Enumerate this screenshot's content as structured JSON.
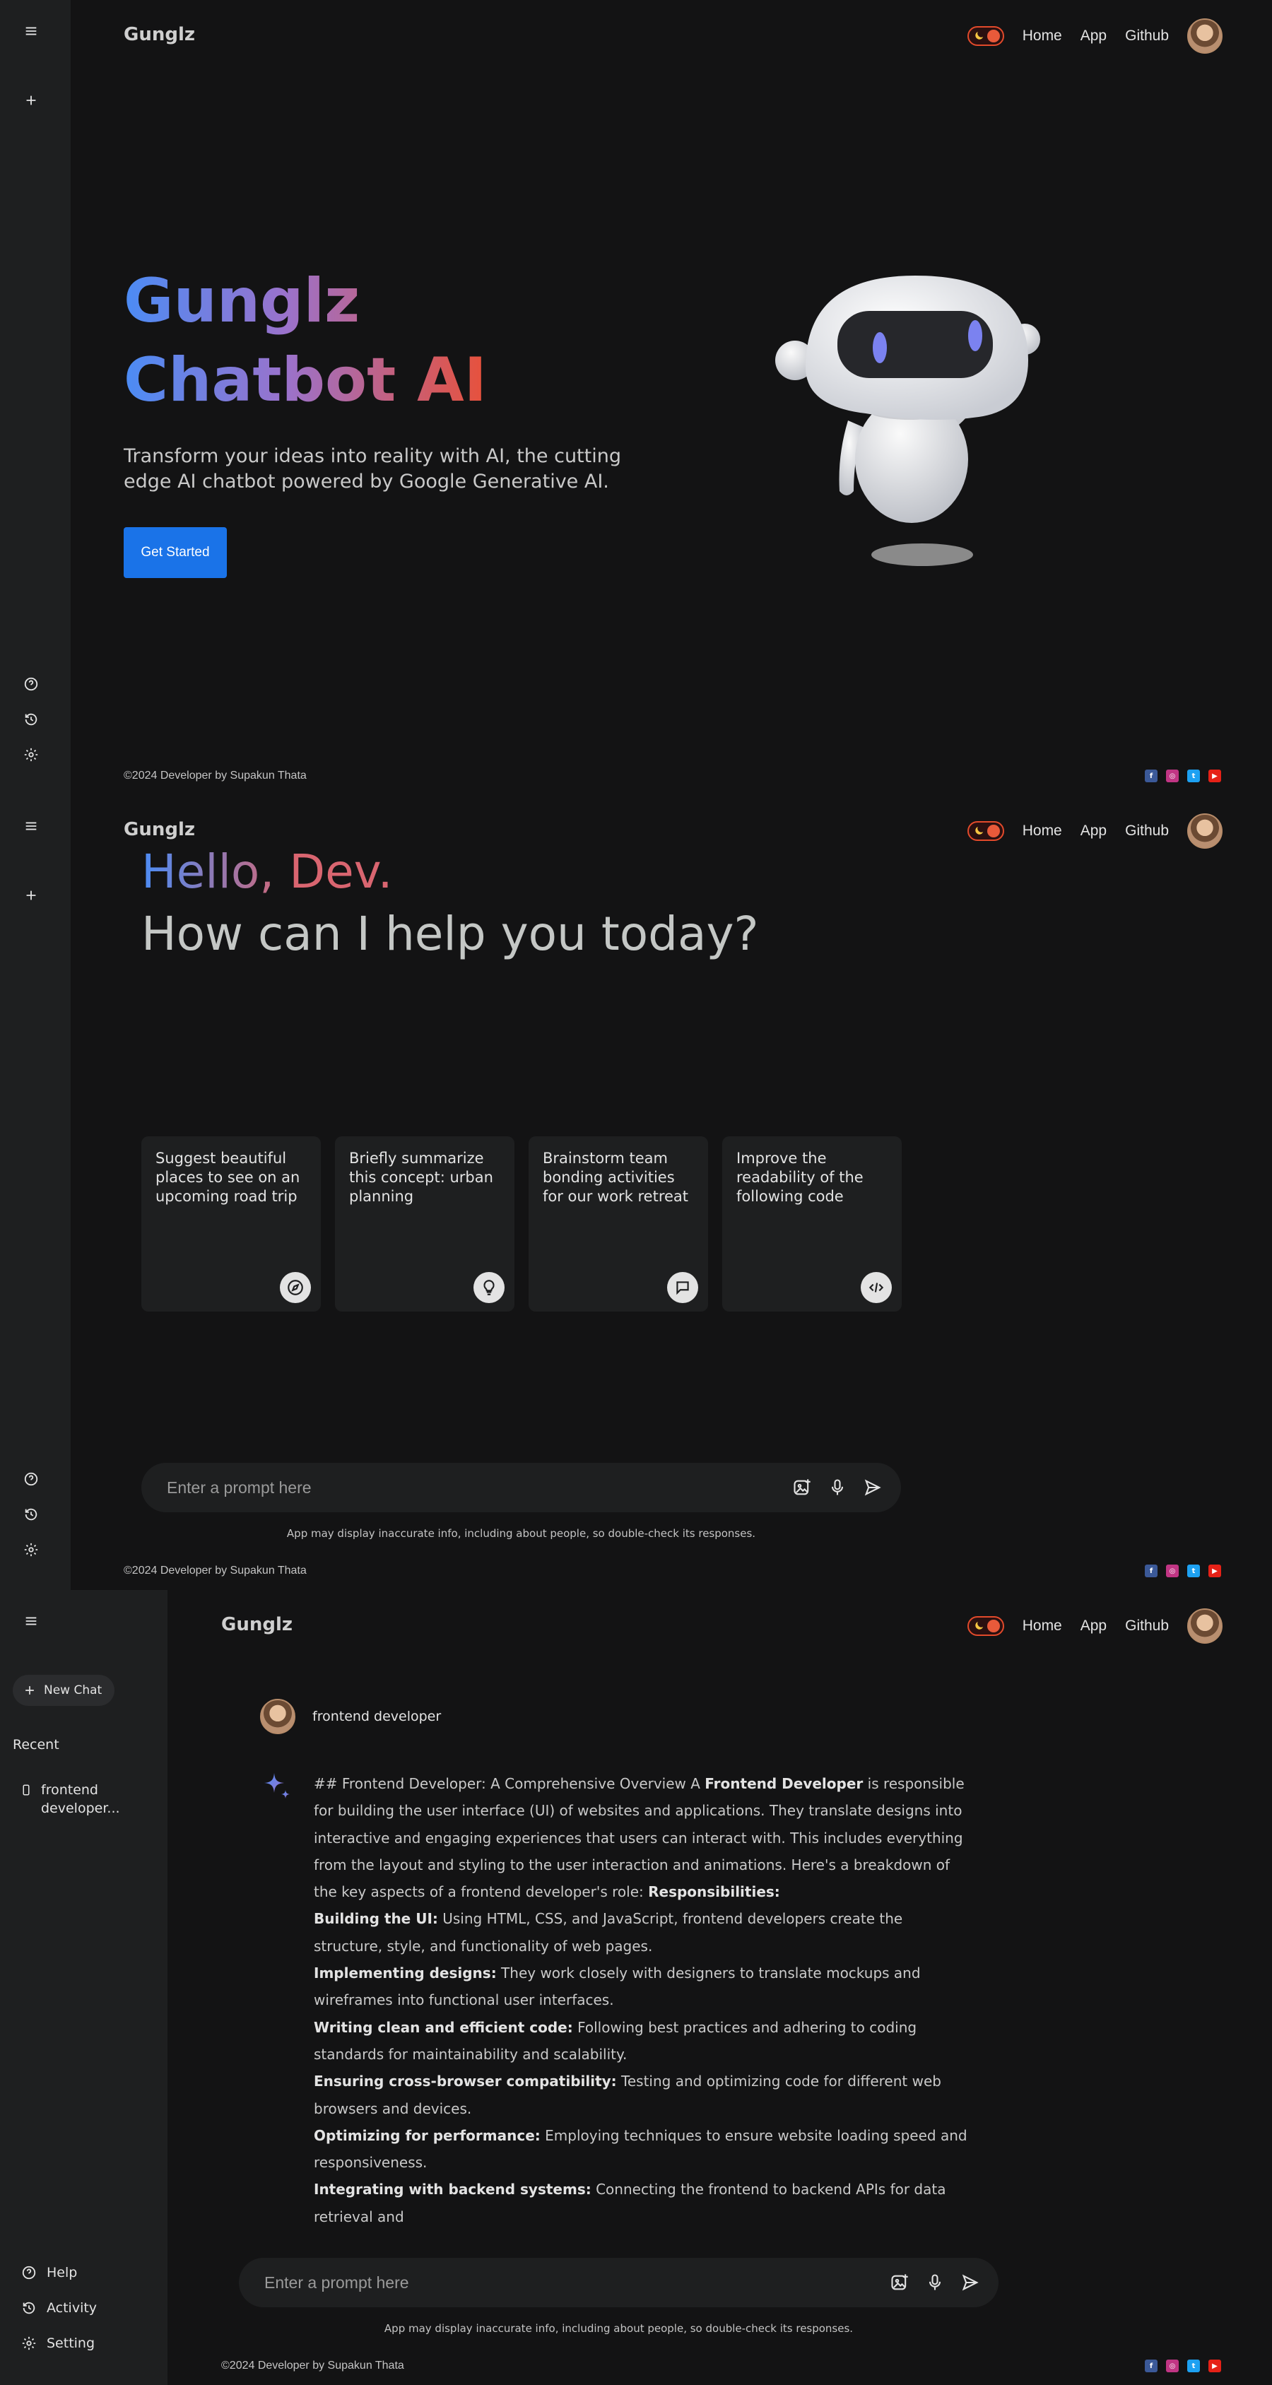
{
  "brand": "Gunglz",
  "nav": {
    "home": "Home",
    "app": "App",
    "github": "Github"
  },
  "footer": {
    "copyright": "©2024 Developer by Supakun Thata"
  },
  "socials": [
    "facebook-icon",
    "instagram-icon",
    "twitter-icon",
    "youtube-icon"
  ],
  "colors": {
    "primary_button": "#1a73e8",
    "toggle_accent": "#e34a2b",
    "gradient_start": "#4b8cf5",
    "gradient_end": "#e8513a"
  },
  "landing": {
    "title_line1": "Gunglz",
    "title_line2": "Chatbot AI",
    "subtitle": "Transform your ideas into reality with AI, the cutting edge AI chatbot powered by Google Generative AI.",
    "cta": "Get Started"
  },
  "home": {
    "greeting": "Hello, Dev.",
    "question": "How can I help you today?",
    "cards": [
      {
        "text": "Suggest beautiful places to see on an upcoming road trip",
        "icon": "compass-icon"
      },
      {
        "text": "Briefly summarize this concept: urban planning",
        "icon": "bulb-icon"
      },
      {
        "text": "Brainstorm team bonding activities for our work retreat",
        "icon": "message-icon"
      },
      {
        "text": "Improve the readability of the following code",
        "icon": "code-icon"
      }
    ]
  },
  "prompt": {
    "placeholder": "Enter a prompt here",
    "disclaimer": "App may display inaccurate info, including about people, so double-check its responses."
  },
  "sidebar": {
    "new_chat": "New Chat",
    "recent_title": "Recent",
    "recent_item": "frontend developer...",
    "help": "Help",
    "activity": "Activity",
    "setting": "Setting"
  },
  "chat": {
    "user_prompt": "frontend developer",
    "answer": {
      "intro_plain": "## Frontend Developer: A Comprehensive Overview A ",
      "intro_bold": "Frontend Developer",
      "intro_rest": " is responsible for building the user interface (UI) of websites and applications. They translate designs into interactive and engaging experiences that users can interact with. This includes everything from the layout and styling to the user interaction and animations. Here's a breakdown of the key aspects of a frontend developer's role: ",
      "resp_heading": "Responsibilities:",
      "items": [
        {
          "title": "Building the UI:",
          "text": " Using HTML, CSS, and JavaScript, frontend developers create the structure, style, and functionality of web pages."
        },
        {
          "title": "Implementing designs:",
          "text": " They work closely with designers to translate mockups and wireframes into functional user interfaces."
        },
        {
          "title": "Writing clean and efficient code:",
          "text": " Following best practices and adhering to coding standards for maintainability and scalability."
        },
        {
          "title": "Ensuring cross-browser compatibility:",
          "text": " Testing and optimizing code for different web browsers and devices."
        },
        {
          "title": "Optimizing for performance:",
          "text": " Employing techniques to ensure website loading speed and responsiveness."
        },
        {
          "title": "Integrating with backend systems:",
          "text": " Connecting the frontend to backend APIs for data retrieval and"
        }
      ]
    }
  }
}
